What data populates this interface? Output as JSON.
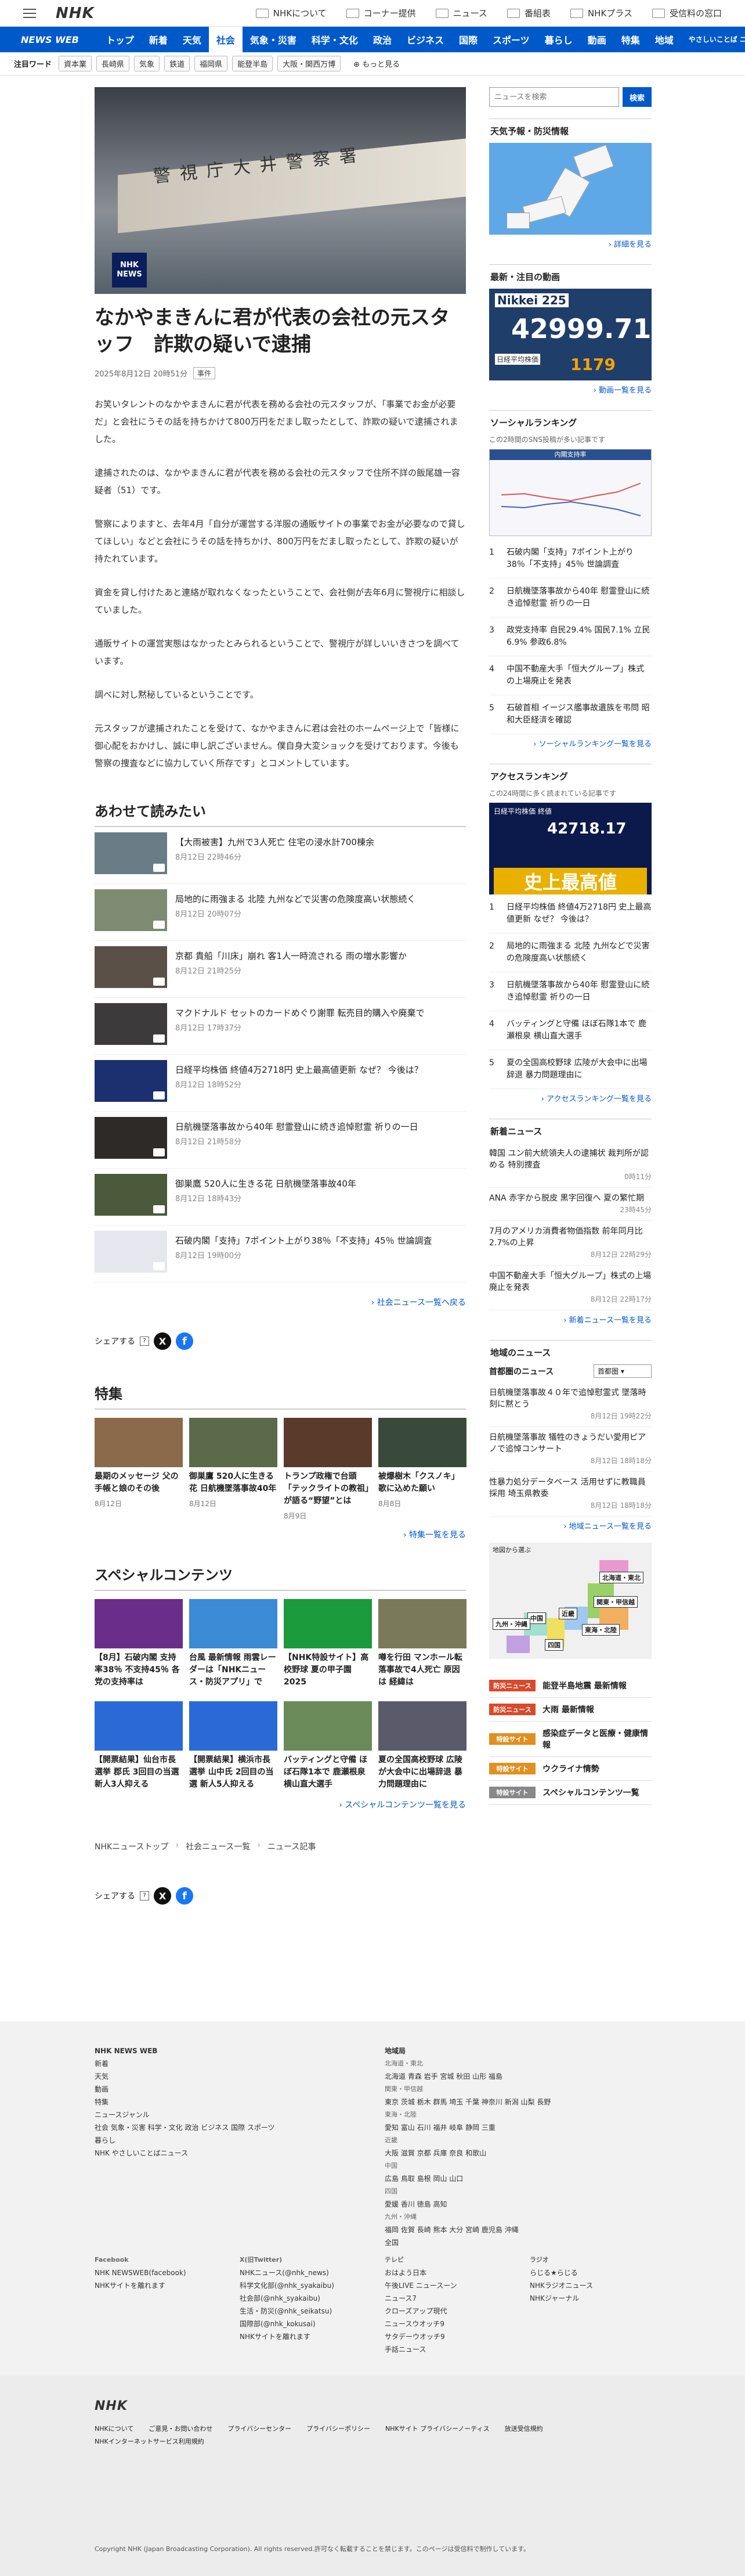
{
  "header": {
    "logo": "NHK",
    "links": [
      "NHKについて",
      "コーナー提供",
      "ニュース",
      "番組表",
      "NHKプラス",
      "受信料の窓口"
    ]
  },
  "nav": {
    "brand": "NEWS WEB",
    "tabs": [
      "トップ",
      "新着",
      "天気",
      "社会",
      "気象・災害",
      "科学・文化",
      "政治",
      "ビジネス",
      "国際",
      "スポーツ",
      "暮らし",
      "動画",
      "特集",
      "地域",
      "やさしいことば ニュース"
    ],
    "active": 3
  },
  "keywords": {
    "label": "注目ワード",
    "items": [
      "資本業",
      "長崎県",
      "気象",
      "鉄道",
      "福岡県",
      "能登半島",
      "大阪・関西万博"
    ],
    "more": "もっと見る"
  },
  "article": {
    "title": "なかやまきんに君が代表の会社の元スタッフ　詐欺の疑いで逮捕",
    "date": "2025年8月12日 20時51分",
    "category": "事件",
    "hero_badge": [
      "NHK",
      "NEWS"
    ],
    "hero_sign": "警視庁大井警察署",
    "paragraphs": [
      "お笑いタレントのなかやまきんに君が代表を務める会社の元スタッフが、「事業でお金が必要だ」と会社にうその話を持ちかけて800万円をだまし取ったとして、詐欺の疑いで逮捕されました。",
      "逮捕されたのは、なかやまきんに君が代表を務める会社の元スタッフで住所不詳の飯尾雄一容疑者（51）です。",
      "警察によりますと、去年4月「自分が運営する洋服の通販サイトの事業でお金が必要なので貸してほしい」などと会社にうその話を持ちかけ、800万円をだまし取ったとして、詐欺の疑いが持たれています。",
      "資金を貸し付けたあと連絡が取れなくなったということで、会社側が去年6月に警視庁に相談していました。",
      "通販サイトの運営実態はなかったとみられるということで、警視庁が詳しいいきさつを調べています。",
      "調べに対し黙秘しているということです。",
      "元スタッフが逮捕されたことを受けて、なかやまきんに君は会社のホームページ上で「皆様に御心配をおかけし、誠に申し訳ございません。僕自身大変ショックを受けております。今後も警察の捜査などに協力していく所存です」とコメントしています。"
    ]
  },
  "related": {
    "heading": "あわせて読みたい",
    "items": [
      {
        "title": "【大雨被害】九州で3人死亡 住宅の浸水計700棟余",
        "date": "8月12日 22時46分",
        "color": "#6a7d86"
      },
      {
        "title": "局地的に雨強まる 北陸 九州などで災害の危険度高い状態続く",
        "date": "8月12日 20時07分",
        "color": "#7d8b73"
      },
      {
        "title": "京都 貴船「川床」崩れ 客1人一時流される 雨の増水影響か",
        "date": "8月12日 21時25分",
        "color": "#5b5048"
      },
      {
        "title": "マクドナルド セットのカードめぐり謝罪 転売目的購入や廃棄で",
        "date": "8月12日 17時37分",
        "color": "#3c3a3a"
      },
      {
        "title": "日経平均株価 終値4万2718円 史上最高値更新 なぜ？ 今後は？",
        "date": "8月12日 18時52分",
        "color": "#1c2f6f"
      },
      {
        "title": "日航機墜落事故から40年 慰霊登山に続き追悼慰霊 祈りの一日",
        "date": "8月12日 21時58分",
        "color": "#2d2a28"
      },
      {
        "title": "御巣鷹 520人に生きる花 日航機墜落事故40年",
        "date": "8月12日 18時43分",
        "color": "#4a5a3a"
      },
      {
        "title": "石破内閣「支持」7ポイント上がり38％「不支持」45％ 世論調査",
        "date": "8月12日 19時00分",
        "color": "#e6e6ee"
      }
    ],
    "more": "社会ニュース一覧へ戻る"
  },
  "share": {
    "label": "シェアする"
  },
  "tokushu": {
    "heading": "特集",
    "items": [
      {
        "title": "最期のメッセージ 父の手帳と娘のその後",
        "date": "8月12日",
        "color": "#8a6a4a"
      },
      {
        "title": "御巣鷹 520人に生きる花 日航機墜落事故40年",
        "date": "8月12日",
        "color": "#5a6a4a"
      },
      {
        "title": "トランプ政権で台頭「テックライトの教祖」が語る“野望”とは",
        "date": "8月9日",
        "color": "#5a3a2a"
      },
      {
        "title": "被爆樹木「クスノキ」歌に込めた願い",
        "date": "8月8日",
        "color": "#3a4a3a"
      }
    ],
    "more": "特集一覧を見る"
  },
  "special": {
    "heading": "スペシャルコンテンツ",
    "items": [
      {
        "title": "【8月】石破内閣 支持率38％ 不支持45％ 各党の支持率は",
        "color": "#6b2d8a"
      },
      {
        "title": "台風 最新情報 雨雲レーダーは「NHKニュース・防災アプリ」で",
        "color": "#3a8ad6"
      },
      {
        "title": "【NHK特設サイト】高校野球 夏の甲子園 2025",
        "color": "#1a9a3a"
      },
      {
        "title": "噂を行田 マンホール転落事故で4人死亡 原因は 経緯は",
        "color": "#7a7a5a"
      },
      {
        "title": "【開票結果】仙台市長選挙 郡氏 3回目の当選 新人3人抑える",
        "color": "#2a6ad6"
      },
      {
        "title": "【開票結果】横浜市長選挙 山中氏 2回目の当選 新人5人抑える",
        "color": "#2a6ad6"
      },
      {
        "title": "バッティングと守備 ほぼ石隊1本で 鹿瀬根泉 横山直大選手",
        "color": "#6a8a5a"
      },
      {
        "title": "夏の全国高校野球 広陵が大会中に出場辞退 暴力問題理由に",
        "color": "#5a5a6a"
      }
    ],
    "more": "スペシャルコンテンツ一覧を見る"
  },
  "breadcrumb": [
    "NHKニューストップ",
    "社会ニュース一覧",
    "ニュース記事"
  ],
  "sidebar": {
    "search": {
      "placeholder": "ニュースを検索",
      "button": "検索"
    },
    "weather": {
      "heading": "天気予報・防災情報",
      "more": "詳細を見る"
    },
    "video": {
      "heading": "最新・注目の動画",
      "nk_label": "Nikkei 225",
      "nk_value": "42999.71",
      "nk_sub": "日経平均株価",
      "nk_change": "1179",
      "more": "動画一覧を見る"
    },
    "social": {
      "heading": "ソーシャルランキング",
      "sub": "この2時間のSNS投稿が多い記事です",
      "chart_caption": "内閣支持率",
      "items": [
        "石破内閣「支持」7ポイント上がり38％「不支持」45％ 世論調査",
        "日航機墜落事故から40年 慰霊登山に続き追悼慰霊 祈りの一日",
        "政党支持率 自民29.4% 国民7.1% 立民6.9% 参政6.8%",
        "中国不動産大手「恒大グループ」株式の上場廃止を発表",
        "石破首相 イージス艦事故遺族を弔問 昭和大臣経済を確認"
      ],
      "more": "ソーシャルランキング一覧を見る"
    },
    "access": {
      "heading": "アクセスランキング",
      "sub": "この24時間に多く読まれている記事です",
      "stock_label": "日経平均株価 終値",
      "stock_value": "42718.17",
      "stock_headline": "史上最高値",
      "items": [
        "日経平均株価 終値4万2718円 史上最高値更新 なぜ？ 今後は？",
        "局地的に雨強まる 北陸 九州などで災害の危険度高い状態続く",
        "日航機墜落事故から40年 慰霊登山に続き追悼慰霊 祈りの一日",
        "バッティングと守備 ほぼ石隊1本で 鹿瀬根泉 横山直大選手",
        "夏の全国高校野球 広陵が大会中に出場辞退 暴力問題理由に"
      ],
      "more": "アクセスランキング一覧を見る"
    },
    "latest": {
      "heading": "新着ニュース",
      "items": [
        {
          "title": "韓国 ユン前大統領夫人の逮捕状 裁判所が認める 特別捜査",
          "date": "0時11分"
        },
        {
          "title": "ANA 赤字から脱皮 黒字回復へ 夏の繁忙期",
          "date": "23時45分"
        },
        {
          "title": "7月のアメリカ消費者物価指数 前年同月比2.7%の上昇",
          "date": "8月12日 22時29分"
        },
        {
          "title": "中国不動産大手「恒大グループ」株式の上場廃止を発表",
          "date": "8月12日 22時17分"
        }
      ],
      "more": "新着ニュース一覧を見る"
    },
    "regional": {
      "heading": "地域のニュース",
      "area_label": "首都圏のニュース",
      "area_value": "首都圏",
      "items": [
        {
          "title": "日航機墜落事故４０年で追悼慰霊式 墜落時刻に黙とう",
          "date": "8月12日 19時22分"
        },
        {
          "title": "日航機墜落事故 犠牲のきょうだい愛用ピアノで追悼コンサート",
          "date": "8月12日 18時18分"
        },
        {
          "title": "性暴力処分データベース 活用せずに教職員採用 埼玉県教委",
          "date": "8月12日 18時18分"
        }
      ],
      "more": "地域ニュース一覧を見る",
      "map_label": "地図から選ぶ",
      "map_areas": [
        "北海道・東北",
        "関東・甲信越",
        "東海・北陸",
        "近畿",
        "中国",
        "四国",
        "九州・沖縄"
      ]
    },
    "features": [
      {
        "tag": "防災ニュース",
        "title": "能登半島地震 最新情報",
        "color": "#d94a2a"
      },
      {
        "tag": "防災ニュース",
        "title": "大雨 最新情報",
        "color": "#d94a2a"
      },
      {
        "tag": "特設サイト",
        "title": "感染症データと医療・健康情報",
        "color": "#e09020"
      },
      {
        "tag": "特設サイト",
        "title": "ウクライナ情勢",
        "color": "#e09020"
      },
      {
        "tag": "特設サイト",
        "title": "スペシャルコンテンツ一覧",
        "color": "#888888"
      }
    ]
  },
  "footer": {
    "brand": "NHK NEWS WEB",
    "col1": [
      "新着",
      "天気",
      "動画",
      "特集",
      "ニュースジャンル",
      "社会 気象・災害 科学・文化 政治 ビジネス 国際 スポーツ",
      "暮らし",
      "NHK やさしいことばニュース"
    ],
    "areas_heading": "地域局",
    "areas": [
      "北海道・東北",
      "北海道 青森 岩手 宮城 秋田 山形 福島",
      "関東・甲信越",
      "東京 茨城 栃木 群馬 埼玉 千葉 神奈川 新潟 山梨 長野",
      "東海・北陸",
      "愛知 富山 石川 福井 岐阜 静岡 三重",
      "近畿",
      "大阪 滋賀 京都 兵庫 奈良 和歌山",
      "中国",
      "広島 鳥取 島根 岡山 山口",
      "四国",
      "愛媛 香川 徳島 高知",
      "九州・沖縄",
      "福岡 佐賀 長崎 熊本 大分 宮崎 鹿児島 沖縄",
      "全国"
    ],
    "sns": [
      {
        "h": "Facebook",
        "items": [
          "NHK NEWSWEB(facebook)",
          "NHKサイトを離れます"
        ]
      },
      {
        "h": "X(旧Twitter)",
        "items": [
          "NHKニュース(@nhk_news)",
          "科学文化部(@nhk_syakaibu)",
          "社会部(@nhk_syakaibu)",
          "生活・防災(@nhk_seikatsu)",
          "国際部(@nhk_kokusai)",
          "NHKサイトを離れます"
        ]
      },
      {
        "h": "テレビ",
        "items": [
          "おはよう日本",
          "午後LIVE ニュースーン",
          "ニュース7",
          "クローズアップ現代",
          "ニュースウオッチ9",
          "サタデーウオッチ9",
          "手話ニュース"
        ]
      },
      {
        "h": "ラジオ",
        "items": [
          "らじる★らじる",
          "NHKラジオニュース",
          "NHKジャーナル"
        ]
      }
    ],
    "bottom_logo": "NHK",
    "bottom_links": [
      "NHKについて",
      "ご意見・お問い合わせ",
      "プライバシーセンター",
      "プライバシーポリシー",
      "NHKサイト プライバシーノーティス",
      "放送受信規約",
      "NHKインターネットサービス利用規約"
    ],
    "copyright": "Copyright NHK (Japan Broadcasting Corporation). All rights reserved.許可なく転載することを禁じます。このページは受信料で制作しています。"
  }
}
